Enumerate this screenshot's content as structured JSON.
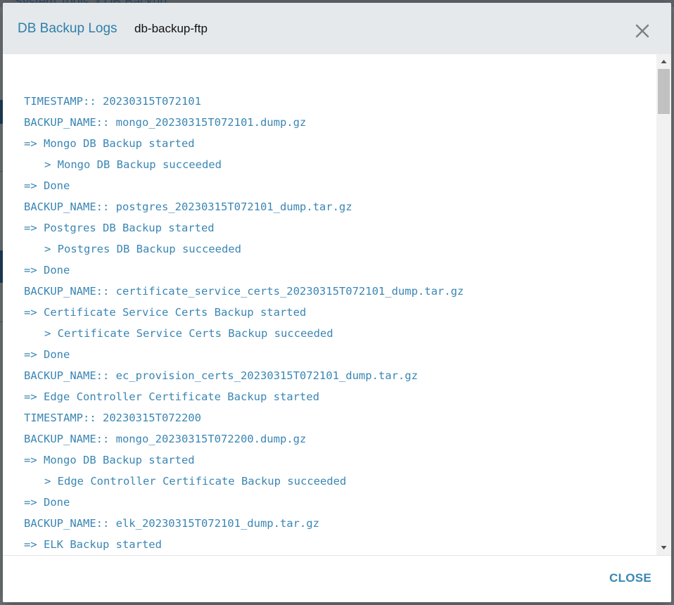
{
  "background": {
    "breadcrumb": "System Tools  >  DB Backup"
  },
  "modal": {
    "title": "DB Backup Logs",
    "subtitle": "db-backup-ftp",
    "close_icon": "close-icon",
    "footer": {
      "close_label": "CLOSE"
    },
    "log_lines": [
      {
        "text": "TIMESTAMP:: 20230315T072101",
        "indent": false
      },
      {
        "text": "BACKUP_NAME:: mongo_20230315T072101.dump.gz",
        "indent": false
      },
      {
        "text": "=> Mongo DB Backup started",
        "indent": false
      },
      {
        "text": "> Mongo DB Backup succeeded",
        "indent": true
      },
      {
        "text": "=> Done",
        "indent": false
      },
      {
        "text": "BACKUP_NAME:: postgres_20230315T072101_dump.tar.gz",
        "indent": false
      },
      {
        "text": "=> Postgres DB Backup started",
        "indent": false
      },
      {
        "text": "> Postgres DB Backup succeeded",
        "indent": true
      },
      {
        "text": "=> Done",
        "indent": false
      },
      {
        "text": "BACKUP_NAME:: certificate_service_certs_20230315T072101_dump.tar.gz",
        "indent": false
      },
      {
        "text": "=> Certificate Service Certs Backup started",
        "indent": false
      },
      {
        "text": "> Certificate Service Certs Backup succeeded",
        "indent": true
      },
      {
        "text": "=> Done",
        "indent": false
      },
      {
        "text": "BACKUP_NAME:: ec_provision_certs_20230315T072101_dump.tar.gz",
        "indent": false
      },
      {
        "text": "=> Edge Controller Certificate Backup started",
        "indent": false
      },
      {
        "text": "TIMESTAMP:: 20230315T072200",
        "indent": false
      },
      {
        "text": "BACKUP_NAME:: mongo_20230315T072200.dump.gz",
        "indent": false
      },
      {
        "text": "=> Mongo DB Backup started",
        "indent": false
      },
      {
        "text": "> Edge Controller Certificate Backup succeeded",
        "indent": true
      },
      {
        "text": "=> Done",
        "indent": false
      },
      {
        "text": "BACKUP_NAME:: elk_20230315T072101_dump.tar.gz",
        "indent": false
      },
      {
        "text": "=> ELK Backup started",
        "indent": false
      }
    ]
  },
  "colors": {
    "accent": "#3a86b4",
    "title": "#2f7fa8",
    "header_bg": "#e5e9ec"
  }
}
